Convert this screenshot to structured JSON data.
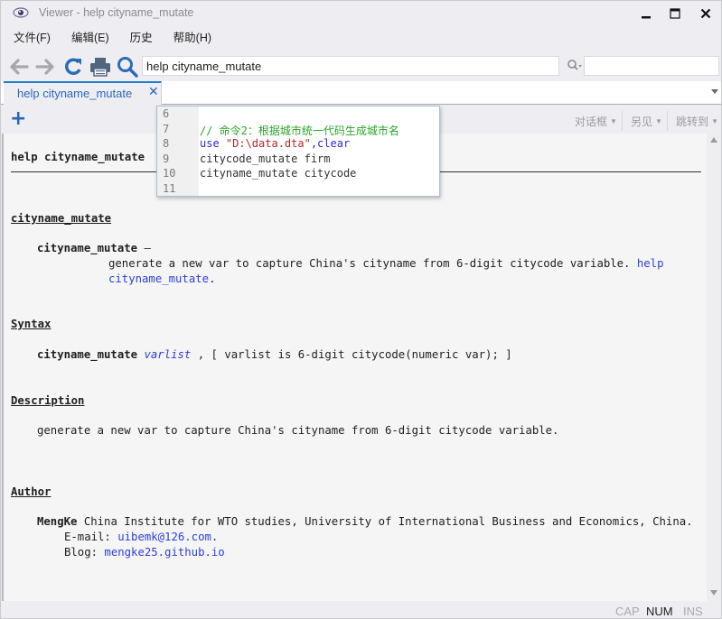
{
  "window": {
    "title": "Viewer - help cityname_mutate",
    "app_icon": "eye-icon",
    "controls": [
      "minimize-icon",
      "maximize-icon",
      "close-icon"
    ]
  },
  "menu": {
    "items": [
      {
        "label": "文件(F)"
      },
      {
        "label": "编辑(E)"
      },
      {
        "label": "历史"
      },
      {
        "label": "帮助(H)"
      }
    ]
  },
  "toolbar": {
    "icons": [
      "back-arrow-icon",
      "forward-arrow-icon",
      "refresh-icon",
      "print-icon",
      "search-icon"
    ],
    "url_value": "help cityname_mutate",
    "find_icon": "find-icon",
    "find_value": ""
  },
  "tabs": [
    {
      "label": "help cityname_mutate",
      "close": "✕"
    }
  ],
  "help_toolbar": {
    "add_label": "+",
    "dialog_label": "对话框",
    "see_also_label": "另见",
    "jump_to_label": "跳转到"
  },
  "content": {
    "header_title": "help cityname_mutate",
    "section1_title": "cityname_mutate",
    "cmd_name": "cityname_mutate",
    "cmd_dash": " —",
    "desc_line1": "generate a new var to capture China's cityname from 6-digit citycode variable.",
    "desc_link1": "help",
    "desc_link2": "cityname_mutate",
    "desc_period": ".",
    "syntax_title": "Syntax",
    "syntax_cmd": "cityname_mutate",
    "syntax_varlist": "varlist",
    "syntax_rest": " , [ varlist is 6-digit citycode(numeric var); ]",
    "description_title": "Description",
    "description_text": "generate a new var to capture China's cityname from 6-digit citycode variable.",
    "author_title": "Author",
    "author_name": "MengKe",
    "author_affiliation": " China Institute for WTO studies, University of International Business and Economics, China.",
    "email_label": "E-mail: ",
    "email_value": "uibemk@126.com",
    "email_period": ".",
    "blog_label": "Blog: ",
    "blog_value": "mengke25.github.io"
  },
  "popup": {
    "lines": [
      {
        "num": "6",
        "parts": []
      },
      {
        "num": "7",
        "parts": [
          {
            "t": "// 命令2：根据城市统一代码生成城市名",
            "c": "comment"
          }
        ]
      },
      {
        "num": "8",
        "parts": [
          {
            "t": "use ",
            "c": "kw"
          },
          {
            "t": "\"D:\\data.dta\"",
            "c": "str"
          },
          {
            "t": ",clear",
            "c": "kw"
          }
        ]
      },
      {
        "num": "9",
        "parts": [
          {
            "t": "citycode_mutate firm",
            "c": "plain"
          }
        ]
      },
      {
        "num": "10",
        "parts": [
          {
            "t": "cityname_mutate citycode",
            "c": "plain"
          }
        ]
      },
      {
        "num": "11",
        "parts": []
      }
    ]
  },
  "status": {
    "cap": "CAP",
    "num": "NUM",
    "ins": "INS",
    "cap_active": false,
    "num_active": true,
    "ins_active": false
  },
  "colors": {
    "accent": "#1e7fcf",
    "link": "#2f3ed6",
    "comment": "#2aa52a",
    "string": "#b8282a"
  }
}
